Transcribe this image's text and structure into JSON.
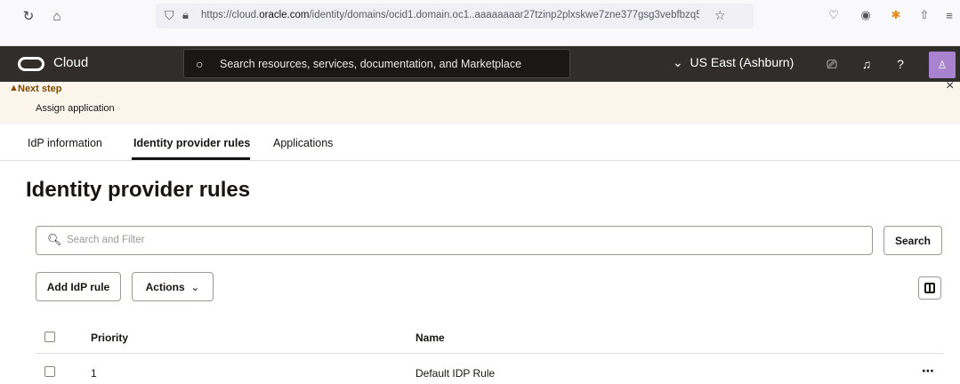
{
  "browser": {
    "url_prefix": "https://cloud.",
    "url_domain": "oracle.com",
    "url_rest": "/identity/domains/ocid1.domain.oc1..aaaaaaaar27tzinp2plxskwe7zne377gsg3vebfbzq5"
  },
  "header": {
    "logo_text": "Cloud",
    "search_placeholder": "Search resources, services, documentation, and Marketplace",
    "region_label": "US East (Ashburn)"
  },
  "banner": {
    "title": "Next step",
    "subtitle": "Assign application"
  },
  "tabs": [
    {
      "label": "IdP information"
    },
    {
      "label": "Identity provider rules"
    },
    {
      "label": "Applications"
    }
  ],
  "page": {
    "title": "Identity provider rules",
    "filter_placeholder": "Search and Filter",
    "search_button": "Search",
    "add_button": "Add IdP rule",
    "actions_button": "Actions"
  },
  "table": {
    "columns": [
      "Priority",
      "Name"
    ],
    "rows": [
      {
        "priority": "1",
        "name": "Default IDP Rule",
        "menu": "⋯"
      }
    ]
  }
}
